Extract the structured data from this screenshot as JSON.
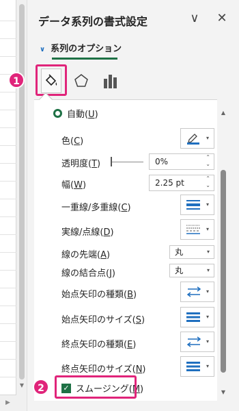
{
  "pane": {
    "title": "データ系列の書式設定",
    "collapse_label": "∨",
    "close_label": "✕",
    "tab_label": "系列のオプション"
  },
  "categories": [
    {
      "name": "fill-line",
      "active": true
    },
    {
      "name": "effects",
      "active": false
    },
    {
      "name": "series-options",
      "active": false
    }
  ],
  "options": {
    "auto": {
      "label": "自動(",
      "key": "U",
      "tail": ")"
    },
    "color": {
      "label": "色(",
      "key": "C",
      "tail": ")"
    },
    "transparency": {
      "label": "透明度(",
      "key": "T",
      "tail": ")",
      "value": "0%"
    },
    "width": {
      "label": "幅(",
      "key": "W",
      "tail": ")",
      "value": "2.25 pt"
    },
    "compound": {
      "label": "一重線/多重線(",
      "key": "C",
      "tail": ")"
    },
    "dash": {
      "label": "実線/点線(",
      "key": "D",
      "tail": ")"
    },
    "cap": {
      "label": "線の先端(",
      "key": "A",
      "tail": ")",
      "value": "丸"
    },
    "join": {
      "label": "線の結合点(",
      "key": "J",
      "tail": ")",
      "value": "丸"
    },
    "begin_arrow_type": {
      "label": "始点矢印の種類(",
      "key": "B",
      "tail": ")"
    },
    "begin_arrow_size": {
      "label": "始点矢印のサイズ(",
      "key": "S",
      "tail": ")"
    },
    "end_arrow_type": {
      "label": "終点矢印の種類(",
      "key": "E",
      "tail": ")"
    },
    "end_arrow_size": {
      "label": "終点矢印のサイズ(",
      "key": "N",
      "tail": ")"
    },
    "smooth": {
      "label": "スムージング(",
      "key": "M",
      "tail": ")",
      "checked": true
    }
  },
  "callouts": {
    "one": "1",
    "two": "2"
  },
  "colors": {
    "accent_green": "#1e7145",
    "accent_blue": "#1f6fbf",
    "highlight": "#e0247a"
  }
}
